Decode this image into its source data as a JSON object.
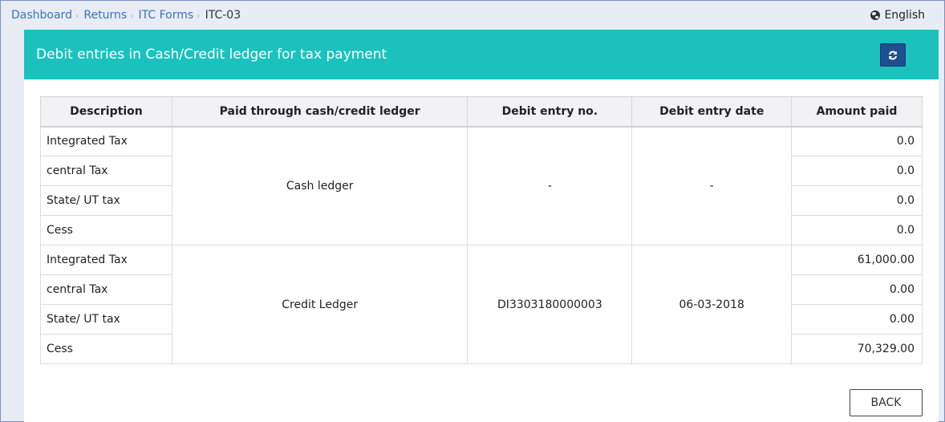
{
  "breadcrumb": {
    "items": [
      "Dashboard",
      "Returns",
      "ITC Forms"
    ],
    "current": "ITC-03",
    "separator": "›"
  },
  "language": {
    "label": "English",
    "icon": "globe-icon"
  },
  "panel": {
    "title": "Debit entries in Cash/Credit ledger for tax payment",
    "refresh_icon": "refresh-icon",
    "header_color": "#1bc2bd",
    "button_color": "#1f4f8f"
  },
  "table": {
    "headers": [
      "Description",
      "Paid through cash/credit ledger",
      "Debit entry no.",
      "Debit entry date",
      "Amount paid"
    ],
    "groups": [
      {
        "ledger": "Cash ledger",
        "entry_no": "-",
        "entry_date": "-",
        "rows": [
          {
            "description": "Integrated Tax",
            "amount": "0.0"
          },
          {
            "description": "central Tax",
            "amount": "0.0"
          },
          {
            "description": "State/ UT tax",
            "amount": "0.0"
          },
          {
            "description": "Cess",
            "amount": "0.0"
          }
        ]
      },
      {
        "ledger": "Credit Ledger",
        "entry_no": "DI3303180000003",
        "entry_date": "06-03-2018",
        "rows": [
          {
            "description": "Integrated Tax",
            "amount": "61,000.00"
          },
          {
            "description": "central Tax",
            "amount": "0.00"
          },
          {
            "description": "State/ UT tax",
            "amount": "0.00"
          },
          {
            "description": "Cess",
            "amount": "70,329.00"
          }
        ]
      }
    ]
  },
  "actions": {
    "back_label": "BACK"
  }
}
